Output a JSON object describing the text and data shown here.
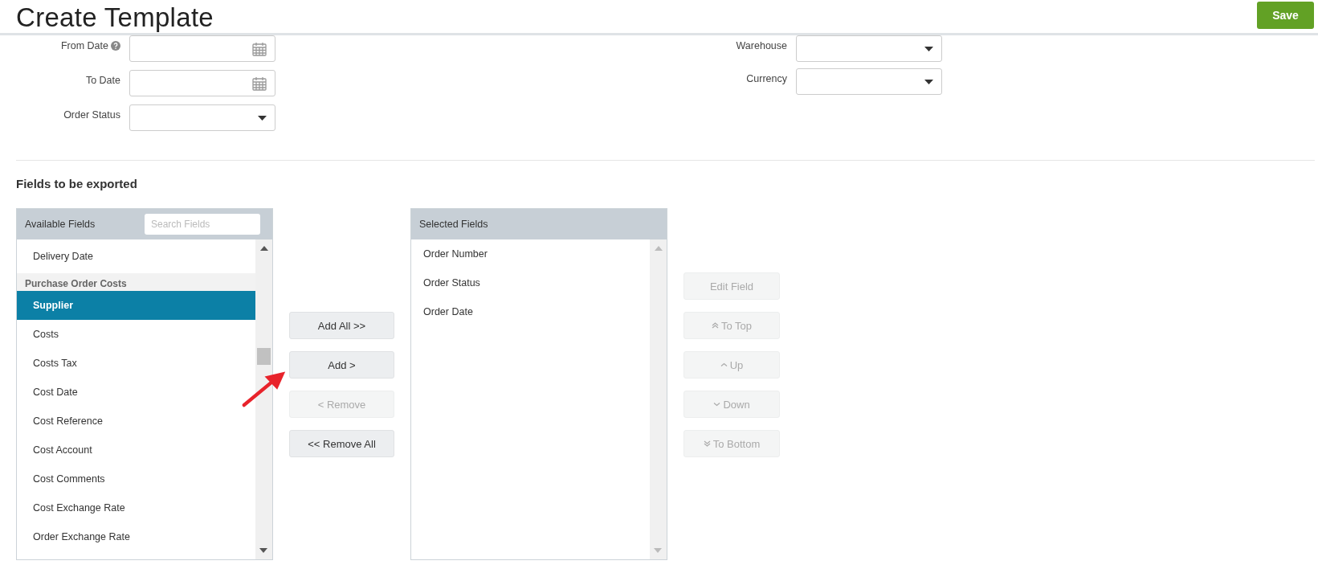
{
  "page": {
    "title": "Create Template",
    "save_button": "Save"
  },
  "filters_left": [
    {
      "label": "From Date",
      "kind": "date",
      "help": true
    },
    {
      "label": "To Date",
      "kind": "date",
      "help": false
    },
    {
      "label": "Order Status",
      "kind": "select",
      "help": false
    }
  ],
  "filters_right": [
    {
      "label": "Warehouse",
      "kind": "select",
      "help": false
    },
    {
      "label": "Currency",
      "kind": "select",
      "help": false
    }
  ],
  "section_title": "Fields to be exported",
  "available_fields": {
    "title": "Available Fields",
    "search_placeholder": "Search Fields",
    "items": [
      {
        "kind": "item",
        "label": "Delivery Date",
        "selected": false
      },
      {
        "kind": "group",
        "label": "Purchase Order Costs"
      },
      {
        "kind": "item",
        "label": "Supplier",
        "selected": true
      },
      {
        "kind": "item",
        "label": "Costs",
        "selected": false
      },
      {
        "kind": "item",
        "label": "Costs Tax",
        "selected": false
      },
      {
        "kind": "item",
        "label": "Cost Date",
        "selected": false
      },
      {
        "kind": "item",
        "label": "Cost Reference",
        "selected": false
      },
      {
        "kind": "item",
        "label": "Cost Account",
        "selected": false
      },
      {
        "kind": "item",
        "label": "Cost Comments",
        "selected": false
      },
      {
        "kind": "item",
        "label": "Cost Exchange Rate",
        "selected": false
      },
      {
        "kind": "item",
        "label": "Order Exchange Rate",
        "selected": false
      }
    ]
  },
  "transfer_buttons": [
    {
      "label": "Add All >>",
      "disabled": false
    },
    {
      "label": "Add >",
      "disabled": false
    },
    {
      "label": "< Remove",
      "disabled": true
    },
    {
      "label": "<< Remove All",
      "disabled": false
    }
  ],
  "selected_fields": {
    "title": "Selected Fields",
    "items": [
      {
        "label": "Order Number",
        "selected": false
      },
      {
        "label": "Order Status",
        "selected": false
      },
      {
        "label": "Order Date",
        "selected": false
      }
    ]
  },
  "order_buttons": [
    {
      "label": "Edit Field",
      "kind": "plain",
      "disabled": true
    },
    {
      "label": "To Top",
      "kind": "top",
      "disabled": true
    },
    {
      "label": "Up",
      "kind": "up",
      "disabled": true
    },
    {
      "label": "Down",
      "kind": "down",
      "disabled": true
    },
    {
      "label": "To Bottom",
      "kind": "bottom",
      "disabled": true
    }
  ]
}
